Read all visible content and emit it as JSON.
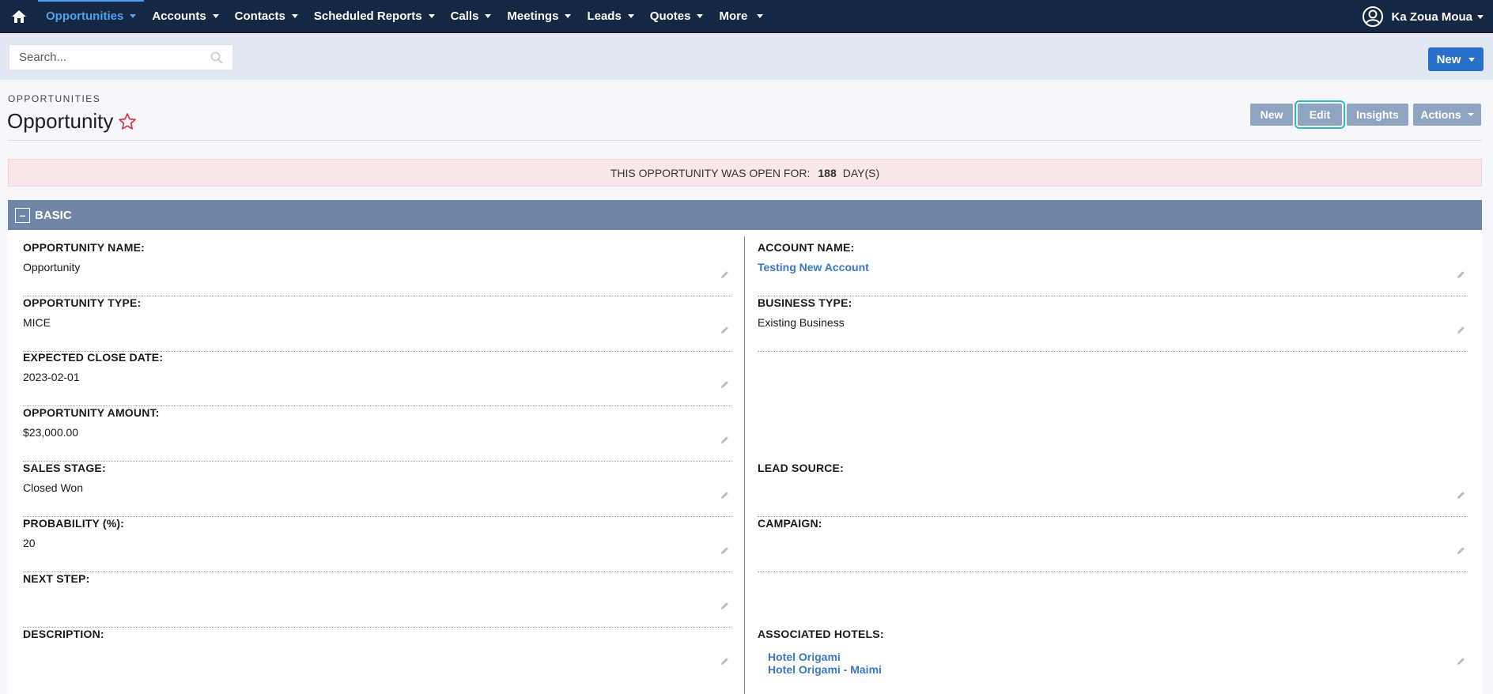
{
  "nav": {
    "items": [
      "Opportunities",
      "Accounts",
      "Contacts",
      "Scheduled Reports",
      "Calls",
      "Meetings",
      "Leads",
      "Quotes",
      "More"
    ],
    "active": "Opportunities",
    "user": "Ka Zoua Moua"
  },
  "search": {
    "placeholder": "Search..."
  },
  "new_button": "New",
  "header": {
    "module": "OPPORTUNITIES",
    "title": "Opportunity"
  },
  "actions": {
    "new": "New",
    "edit": "Edit",
    "insights": "Insights",
    "actions": "Actions"
  },
  "alert": {
    "prefix": "THIS OPPORTUNITY WAS OPEN FOR:",
    "days": "188",
    "suffix": "DAY(S)"
  },
  "panel": {
    "title": "BASIC",
    "collapse": "–",
    "left": [
      {
        "label": "OPPORTUNITY NAME:",
        "value": "Opportunity"
      },
      {
        "label": "OPPORTUNITY TYPE:",
        "value": "MICE"
      },
      {
        "label": "EXPECTED CLOSE DATE:",
        "value": "2023-02-01"
      },
      {
        "label": "OPPORTUNITY AMOUNT:",
        "value": "$23,000.00"
      },
      {
        "label": "SALES STAGE:",
        "value": "Closed Won"
      },
      {
        "label": "PROBABILITY (%):",
        "value": "20"
      },
      {
        "label": "NEXT STEP:",
        "value": ""
      },
      {
        "label": "DESCRIPTION:",
        "value": ""
      }
    ],
    "right": {
      "account_name": {
        "label": "ACCOUNT NAME:",
        "value": "Testing New Account"
      },
      "business_type": {
        "label": "BUSINESS TYPE:",
        "value": "Existing Business"
      },
      "lead_source": {
        "label": "LEAD SOURCE:",
        "value": ""
      },
      "campaign": {
        "label": "CAMPAIGN:",
        "value": ""
      },
      "associated_hotels": {
        "label": "ASSOCIATED HOTELS:",
        "values": [
          "Hotel Origami",
          "Hotel Origami - Maimi"
        ]
      }
    }
  },
  "colors": {
    "nav_bg": "#142743",
    "active": "#4aa4f0",
    "primary": "#2a6fc9",
    "panel_head": "#6f86a6",
    "link": "#3a78c2",
    "alert_bg": "#f8e6e8"
  }
}
